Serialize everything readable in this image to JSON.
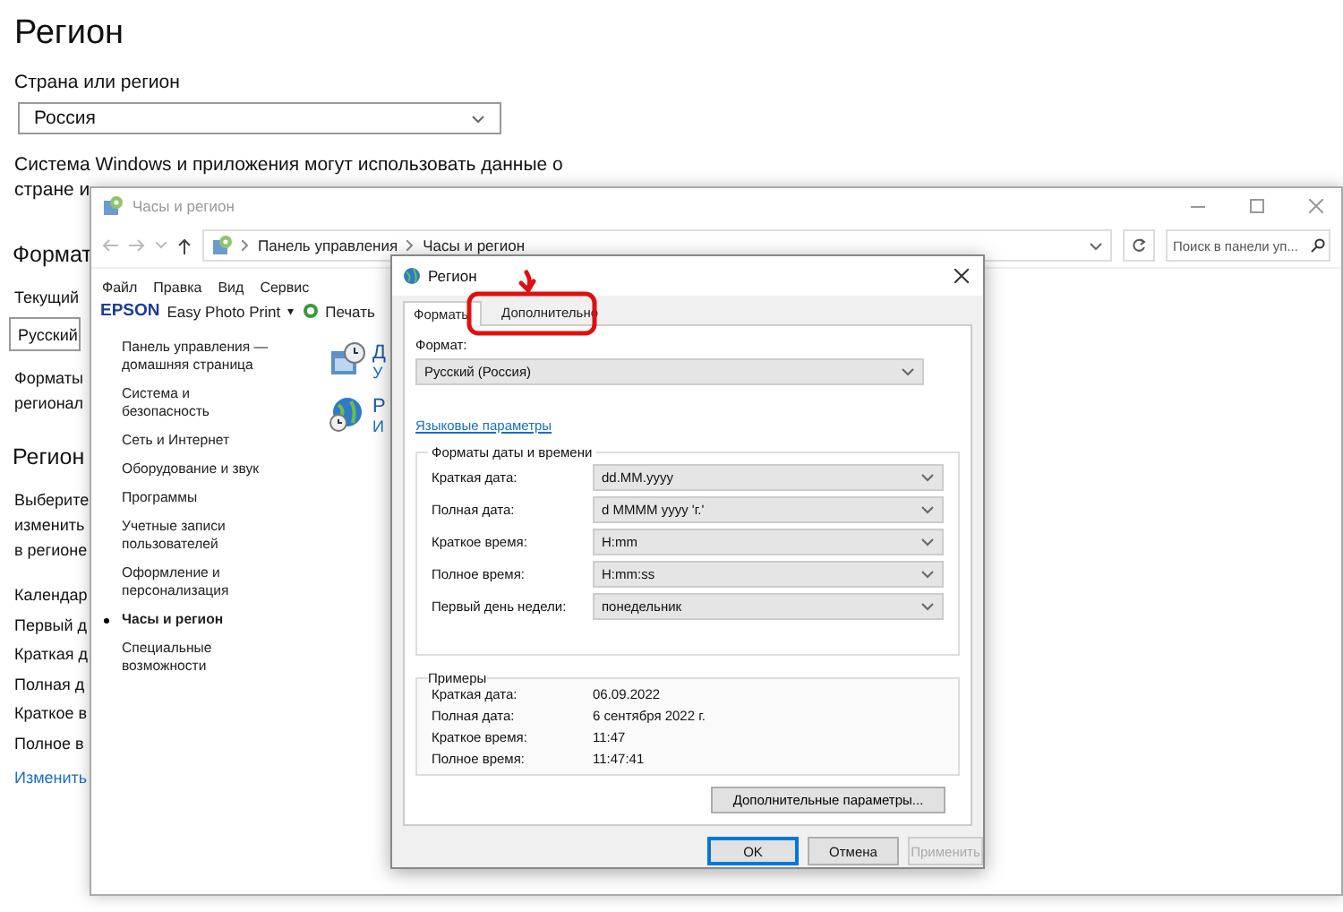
{
  "settings": {
    "title": "Регион",
    "country_label": "Страна или регион",
    "country_value": "Россия",
    "description_lines": [
      "Система Windows и приложения могут использовать данные о",
      "стране и"
    ],
    "format_section": {
      "heading": "Формат",
      "current_label": "Текущий",
      "current_value": "Русский",
      "note_lines": [
        "Форматы",
        "регионал"
      ]
    },
    "region_section": {
      "heading": "Регион",
      "note_lines": [
        "Выберите",
        "изменить",
        "в регионе"
      ],
      "rows": [
        "Календар",
        "Первый д",
        "Краткая д",
        "Полная д",
        "Краткое в",
        "Полное в"
      ],
      "link": "Изменить"
    }
  },
  "control_panel": {
    "title": "Часы и регион",
    "breadcrumb": [
      "Панель управления",
      "Часы и регион"
    ],
    "search": {
      "placeholder": "Поиск в панели уп..."
    },
    "menu": [
      "Файл",
      "Правка",
      "Вид",
      "Сервис"
    ],
    "toolbar": {
      "brand": "EPSON",
      "app": "Easy Photo Print",
      "app_caret": "▾",
      "print": "Печать"
    },
    "sidebar": [
      {
        "label": "Панель управления — домашняя страница",
        "selected": false
      },
      {
        "label": "Система и безопасность",
        "selected": false
      },
      {
        "label": "Сеть и Интернет",
        "selected": false
      },
      {
        "label": "Оборудование и звук",
        "selected": false
      },
      {
        "label": "Программы",
        "selected": false
      },
      {
        "label": "Учетные записи пользователей",
        "selected": false
      },
      {
        "label": "Оформление и персонализация",
        "selected": false
      },
      {
        "label": "Часы и регион",
        "selected": true
      },
      {
        "label": "Специальные возможности",
        "selected": false
      }
    ],
    "categories": [
      {
        "kind": "clock",
        "title": "Д",
        "subtitle": "У"
      },
      {
        "kind": "globe",
        "title": "Р",
        "subtitle": "И"
      }
    ]
  },
  "dialog": {
    "title": "Регион",
    "tabs": [
      {
        "label": "Форматы",
        "selected": true
      },
      {
        "label": "Дополнительно",
        "selected": false
      }
    ],
    "format_label": "Формат:",
    "format_value": "Русский (Россия)",
    "language_link": "Языковые параметры",
    "date_time_group": {
      "title": "Форматы даты и времени",
      "rows": [
        {
          "label": "Краткая дата:",
          "value": "dd.MM.yyyy"
        },
        {
          "label": "Полная дата:",
          "value": "d MMMM yyyy 'г.'"
        },
        {
          "label": "Краткое время:",
          "value": "H:mm"
        },
        {
          "label": "Полное время:",
          "value": "H:mm:ss"
        },
        {
          "label": "Первый день недели:",
          "value": "понедельник"
        }
      ]
    },
    "examples": {
      "title": "Примеры",
      "rows": [
        {
          "label": "Краткая дата:",
          "value": "06.09.2022"
        },
        {
          "label": "Полная дата:",
          "value": "6 сентября 2022 г."
        },
        {
          "label": "Краткое время:",
          "value": "11:47"
        },
        {
          "label": "Полное время:",
          "value": "11:47:41"
        }
      ]
    },
    "more_button": "Дополнительные параметры...",
    "buttons": [
      {
        "label": "OK",
        "default": true,
        "disabled": false
      },
      {
        "label": "Отмена",
        "default": false,
        "disabled": false
      },
      {
        "label": "Применить",
        "default": false,
        "disabled": true
      }
    ]
  }
}
